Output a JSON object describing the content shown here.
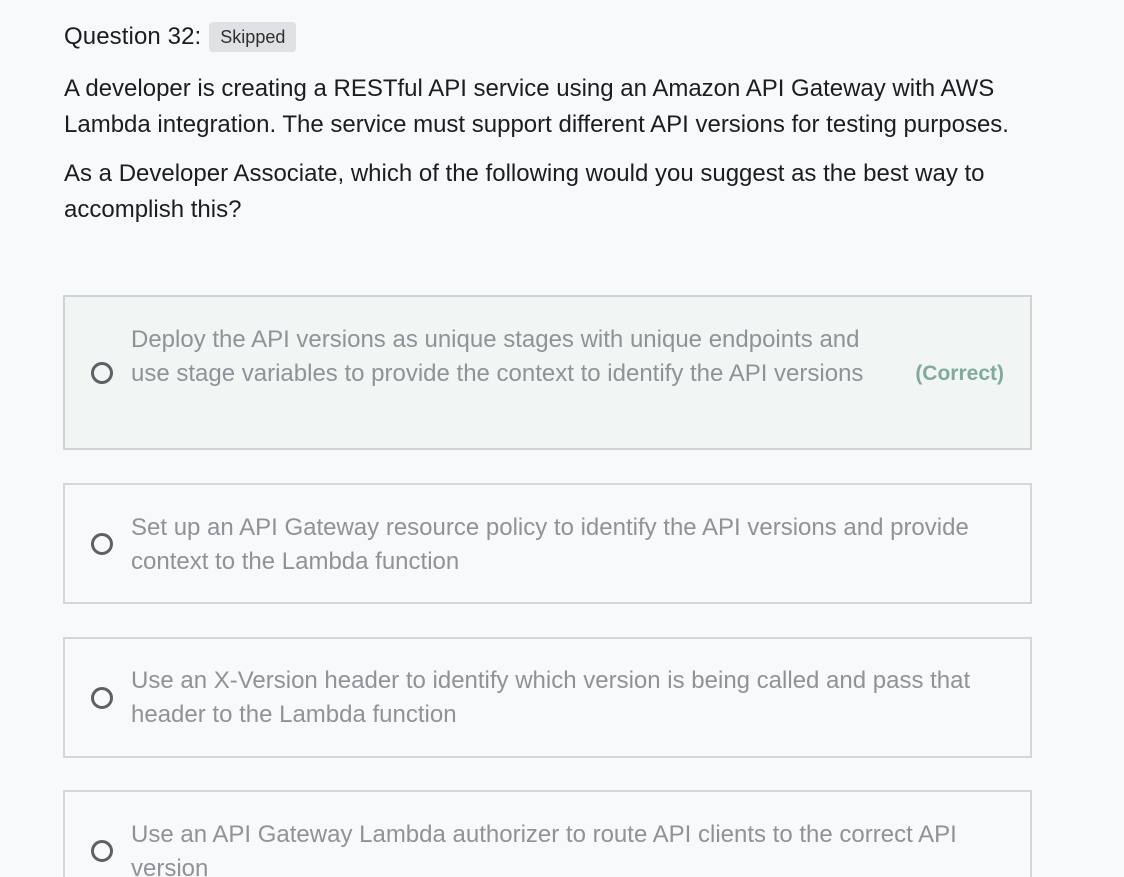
{
  "question": {
    "title": "Question 32:",
    "status_badge": "Skipped",
    "prompt_paragraphs": [
      "A developer is creating a RESTful API service using an Amazon API Gateway with AWS Lambda integration. The service must support different API versions for testing purposes.",
      "As a Developer Associate, which of the following would you suggest as the best way to accomplish this?"
    ]
  },
  "options": [
    {
      "text": "Deploy the API versions as unique stages with unique endpoints and use stage variables to provide the context to identify the API versions",
      "tag": "(Correct)"
    },
    {
      "text": "Set up an API Gateway resource policy to identify the API versions and provide context to the Lambda function"
    },
    {
      "text": "Use an X-Version header to identify which version is being called and pass that header to the Lambda function"
    },
    {
      "text": "Use an API Gateway Lambda authorizer to route API clients to the correct API version"
    }
  ],
  "colors": {
    "correct_accent": "#80ab9b",
    "correct_background": "#f1f5f3",
    "badge_background": "#dfe1e4"
  }
}
